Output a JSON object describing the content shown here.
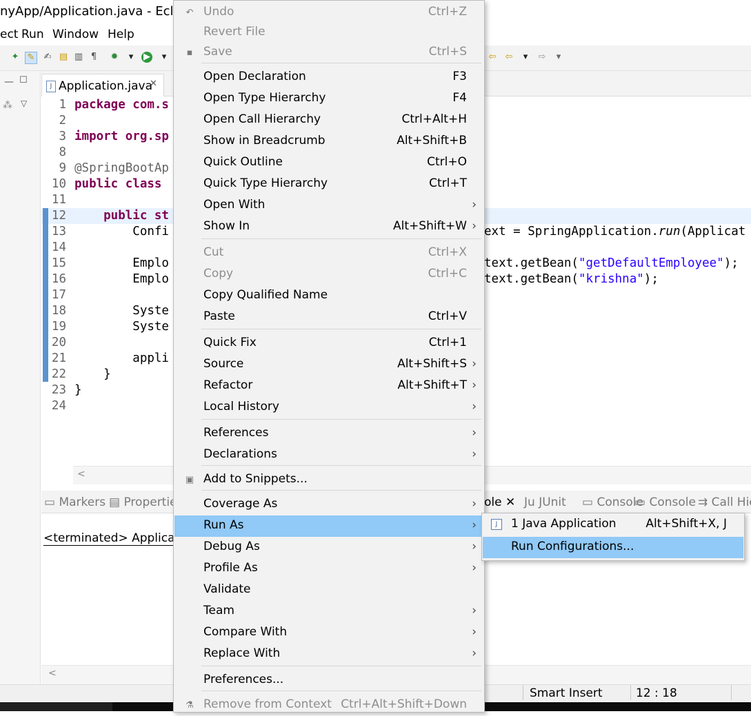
{
  "window": {
    "title": "nyApp/Application.java - Eclipse"
  },
  "menubar": [
    "ect",
    "Run",
    "Window",
    "Help"
  ],
  "editor": {
    "tab_label": "Application.java",
    "lines": [
      {
        "n": "1",
        "code": "package com.s"
      },
      {
        "n": "2",
        "code": ""
      },
      {
        "n": "3",
        "code": "import org.sp"
      },
      {
        "n": "8",
        "code": ""
      },
      {
        "n": "9",
        "code": "@SpringBootAp"
      },
      {
        "n": "10",
        "code": "public class "
      },
      {
        "n": "11",
        "code": ""
      },
      {
        "n": "12",
        "code": "    public st"
      },
      {
        "n": "13",
        "code": "        Confi"
      },
      {
        "n": "14",
        "code": ""
      },
      {
        "n": "15",
        "code": "        Emplo"
      },
      {
        "n": "16",
        "code": "        Emplo"
      },
      {
        "n": "17",
        "code": ""
      },
      {
        "n": "18",
        "code": "        Syste"
      },
      {
        "n": "19",
        "code": "        Syste"
      },
      {
        "n": "20",
        "code": ""
      },
      {
        "n": "21",
        "code": "        appli"
      },
      {
        "n": "22",
        "code": "    }"
      },
      {
        "n": "23",
        "code": "}"
      },
      {
        "n": "24",
        "code": ""
      }
    ],
    "right_code": {
      "line13_a": "ext = SpringApplication.",
      "line13_run": "run",
      "line13_b": "(Applicat",
      "line15_a": "text.getBean(",
      "line15_str": "\"getDefaultEmployee\"",
      "line15_b": ");",
      "line16_a": "text.getBean(",
      "line16_str": "\"krishna\"",
      "line16_b": ");"
    }
  },
  "panel": {
    "tabs_left": [
      "Markers",
      "Properties"
    ],
    "tabs_right": [
      "ole",
      "JUnit",
      "Console",
      "Console",
      "Call Hie"
    ],
    "terminated": "<terminated> Applicatio"
  },
  "status": {
    "insert_mode": "Smart Insert",
    "position": "12 : 18"
  },
  "context_menu": {
    "items": [
      {
        "label": "Undo",
        "shortcut": "Ctrl+Z",
        "disabled": true
      },
      {
        "label": "Revert File",
        "shortcut": "",
        "disabled": true
      },
      {
        "label": "Save",
        "shortcut": "Ctrl+S",
        "disabled": true
      },
      {
        "label": "Open Declaration",
        "shortcut": "F3"
      },
      {
        "label": "Open Type Hierarchy",
        "shortcut": "F4"
      },
      {
        "label": "Open Call Hierarchy",
        "shortcut": "Ctrl+Alt+H"
      },
      {
        "label": "Show in Breadcrumb",
        "shortcut": "Alt+Shift+B"
      },
      {
        "label": "Quick Outline",
        "shortcut": "Ctrl+O"
      },
      {
        "label": "Quick Type Hierarchy",
        "shortcut": "Ctrl+T"
      },
      {
        "label": "Open With",
        "shortcut": ""
      },
      {
        "label": "Show In",
        "shortcut": "Alt+Shift+W"
      },
      {
        "label": "Cut",
        "shortcut": "Ctrl+X",
        "disabled": true
      },
      {
        "label": "Copy",
        "shortcut": "Ctrl+C",
        "disabled": true
      },
      {
        "label": "Copy Qualified Name",
        "shortcut": ""
      },
      {
        "label": "Paste",
        "shortcut": "Ctrl+V"
      },
      {
        "label": "Quick Fix",
        "shortcut": "Ctrl+1"
      },
      {
        "label": "Source",
        "shortcut": "Alt+Shift+S"
      },
      {
        "label": "Refactor",
        "shortcut": "Alt+Shift+T"
      },
      {
        "label": "Local History",
        "shortcut": ""
      },
      {
        "label": "References",
        "shortcut": ""
      },
      {
        "label": "Declarations",
        "shortcut": ""
      },
      {
        "label": "Add to Snippets...",
        "shortcut": ""
      },
      {
        "label": "Coverage As",
        "shortcut": ""
      },
      {
        "label": "Run As",
        "shortcut": "",
        "selected": true
      },
      {
        "label": "Debug As",
        "shortcut": ""
      },
      {
        "label": "Profile As",
        "shortcut": ""
      },
      {
        "label": "Validate",
        "shortcut": ""
      },
      {
        "label": "Team",
        "shortcut": ""
      },
      {
        "label": "Compare With",
        "shortcut": ""
      },
      {
        "label": "Replace With",
        "shortcut": ""
      },
      {
        "label": "Preferences...",
        "shortcut": ""
      },
      {
        "label": "Remove from Context",
        "shortcut": "Ctrl+Alt+Shift+Down",
        "disabled": true
      }
    ]
  },
  "submenu": {
    "items": [
      {
        "label": "1 Java Application",
        "shortcut": "Alt+Shift+X, J"
      },
      {
        "label": "Run Configurations...",
        "shortcut": "",
        "selected": true
      }
    ]
  },
  "colors": {
    "selection": "#91c9f7",
    "keyword": "#7f0055",
    "string": "#2a00ff",
    "menu_bg": "#f2f2f2"
  }
}
